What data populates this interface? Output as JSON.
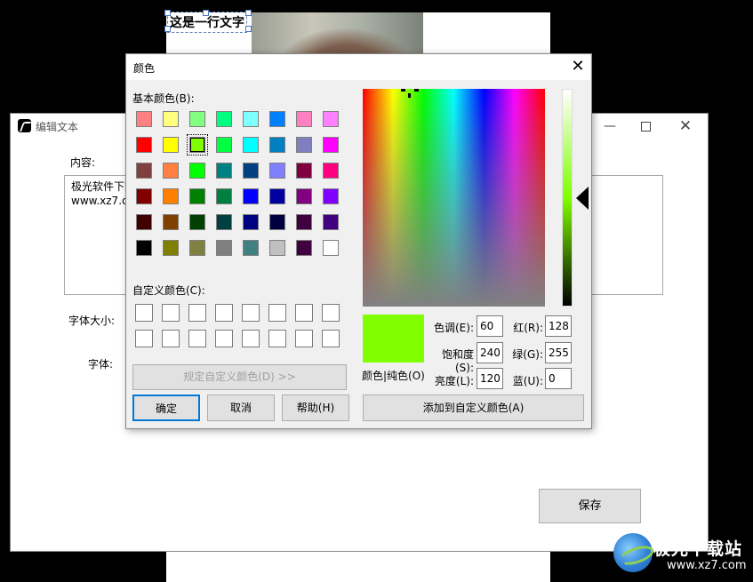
{
  "editor": {
    "canvas_text": "这是一行文字"
  },
  "edit_window": {
    "title": "编辑文本",
    "content_label": "内容:",
    "content_text": "极光软件下载\nwww.xz7.com",
    "font_size_label": "字体大小:",
    "font_label": "字体:",
    "save_label": "保存"
  },
  "color_dialog": {
    "title": "颜色",
    "basic_colors_label": "基本颜色(B):",
    "custom_colors_label": "自定义颜色(C):",
    "basic_colors": [
      "#ff8080",
      "#ffff80",
      "#80ff80",
      "#00ff80",
      "#80ffff",
      "#0080ff",
      "#ff80c0",
      "#ff80ff",
      "#ff0000",
      "#ffff00",
      "#80ff00",
      "#00ff40",
      "#00ffff",
      "#0080c0",
      "#8080c0",
      "#ff00ff",
      "#804040",
      "#ff8040",
      "#00ff00",
      "#008080",
      "#004080",
      "#8080ff",
      "#800040",
      "#ff0080",
      "#800000",
      "#ff8000",
      "#008000",
      "#008040",
      "#0000ff",
      "#0000a0",
      "#800080",
      "#8000ff",
      "#400000",
      "#804000",
      "#004000",
      "#004040",
      "#000080",
      "#000040",
      "#400040",
      "#400080",
      "#000000",
      "#808000",
      "#808040",
      "#808080",
      "#408080",
      "#c0c0c0",
      "#400040",
      "#ffffff"
    ],
    "selected_index": 10,
    "define_custom_label": "规定自定义颜色(D) >>",
    "ok_label": "确定",
    "cancel_label": "取消",
    "help_label": "帮助(H)",
    "add_custom_label": "添加到自定义颜色(A)",
    "solid_label": "颜色|纯色(O)",
    "hue_label": "色调(E):",
    "sat_label": "饱和度(S):",
    "lum_label": "亮度(L):",
    "red_label": "红(R):",
    "green_label": "绿(G):",
    "blue_label": "蓝(U):",
    "hue": "60",
    "sat": "240",
    "lum": "120",
    "red": "128",
    "green": "255",
    "blue": "0",
    "current_color": "#80ff00"
  },
  "watermark": {
    "title": "极光下载站",
    "url": "www.xz7.com"
  }
}
